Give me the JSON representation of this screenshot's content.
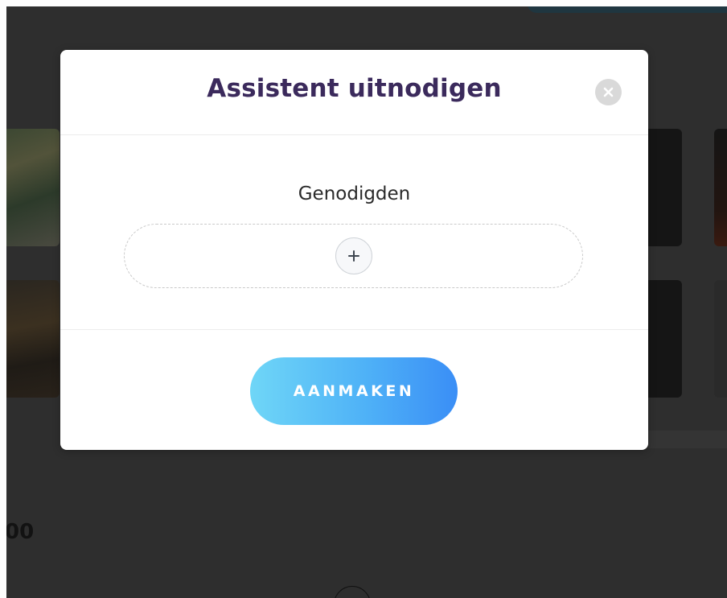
{
  "background": {
    "price_fragment": "00"
  },
  "modal": {
    "title": "Assistent uitnodigen",
    "close_icon": "close-icon",
    "body": {
      "invitees_label": "Genodigden",
      "add_icon": "plus-icon"
    },
    "footer": {
      "create_label": "AANMAKEN"
    }
  },
  "colors": {
    "overlay": "#2e2e2e",
    "title": "#3b2a5c",
    "button_gradient_start": "#6fd6f7",
    "button_gradient_end": "#3a8ef6",
    "close_button_bg": "#d9d9d9"
  }
}
